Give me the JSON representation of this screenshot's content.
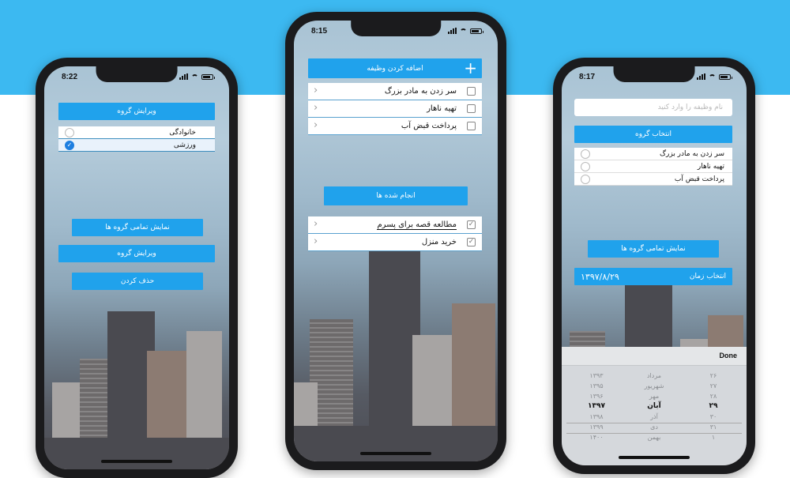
{
  "colors": {
    "background_top": "#3cb9f1",
    "button": "#20a2ec",
    "phone": "#1b1b1d"
  },
  "phone_left": {
    "time": "8:22",
    "edit_group_header": "ویرایش گروه",
    "groups": [
      {
        "label": "خانوادگی",
        "selected": false
      },
      {
        "label": "ورزشی",
        "selected": true
      }
    ],
    "show_all_groups": "نمایش تمامی گروه ها",
    "edit_group": "ویرایش گروه",
    "delete": "حذف کردن"
  },
  "phone_middle": {
    "time": "8:15",
    "add_task": "اضافه کردن وظیفه",
    "tasks": [
      {
        "label": "سر زدن به مادر بزرگ"
      },
      {
        "label": "تهیه ناهار"
      },
      {
        "label": "پرداخت قبض آب"
      }
    ],
    "done_button": "انجام شده ها",
    "done_tasks": [
      {
        "label": "مطالعه قصه برای پسرم"
      },
      {
        "label": "خرید منزل"
      }
    ]
  },
  "phone_right": {
    "time": "8:17",
    "task_name_placeholder": "نام وظیفه را وارد کنید",
    "select_group": "انتخاب گروه",
    "choices": [
      {
        "label": "سر زدن به مادر بزرگ"
      },
      {
        "label": "تهیه ناهار"
      },
      {
        "label": "پرداخت قبض آب"
      }
    ],
    "show_all_groups": "نمایش تمامی گروه ها",
    "select_time": "انتخاب زمان",
    "date_value": "۱۳۹۷/۸/۲۹",
    "done": "Done",
    "picker": {
      "days": [
        "۲۶",
        "۲۷",
        "۲۸",
        "۲۹",
        "۳۰",
        "۳۱",
        "۱"
      ],
      "months": [
        "مرداد",
        "شهریور",
        "مهر",
        "آبان",
        "آذر",
        "دی",
        "بهمن"
      ],
      "years": [
        "۱۳۹۳",
        "۱۳۹۵",
        "۱۳۹۶",
        "۱۳۹۷",
        "۱۳۹۸",
        "۱۳۹۹",
        "۱۴۰۰"
      ]
    }
  }
}
